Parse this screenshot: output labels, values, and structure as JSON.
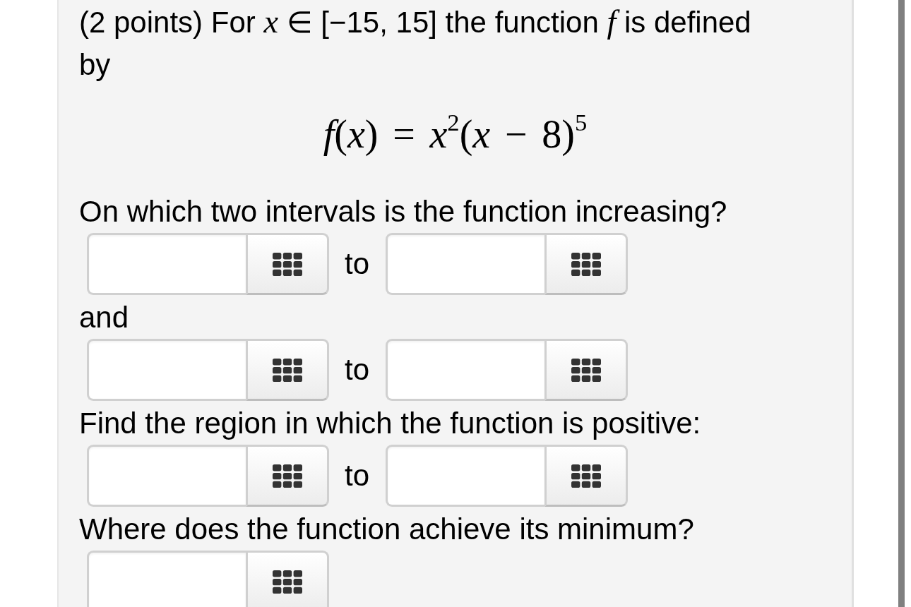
{
  "problem": {
    "intro": "(2 points) For *x* ∈ [−15, 15] the function *f* is defined by",
    "formula": "*f*(*x*) = *x*$^{2}$(*x* − 8)$^{5}$"
  },
  "blocks": [
    {
      "kind": "prompt",
      "text": "On which two intervals is the function increasing?"
    },
    {
      "kind": "range",
      "joiner": "to"
    },
    {
      "kind": "prompt",
      "text": "and"
    },
    {
      "kind": "range",
      "joiner": "to"
    },
    {
      "kind": "prompt",
      "text": "Find the region in which the function is positive:"
    },
    {
      "kind": "range",
      "joiner": "to"
    },
    {
      "kind": "prompt",
      "text": "Where does the function achieve its minimum?"
    },
    {
      "kind": "single"
    }
  ]
}
